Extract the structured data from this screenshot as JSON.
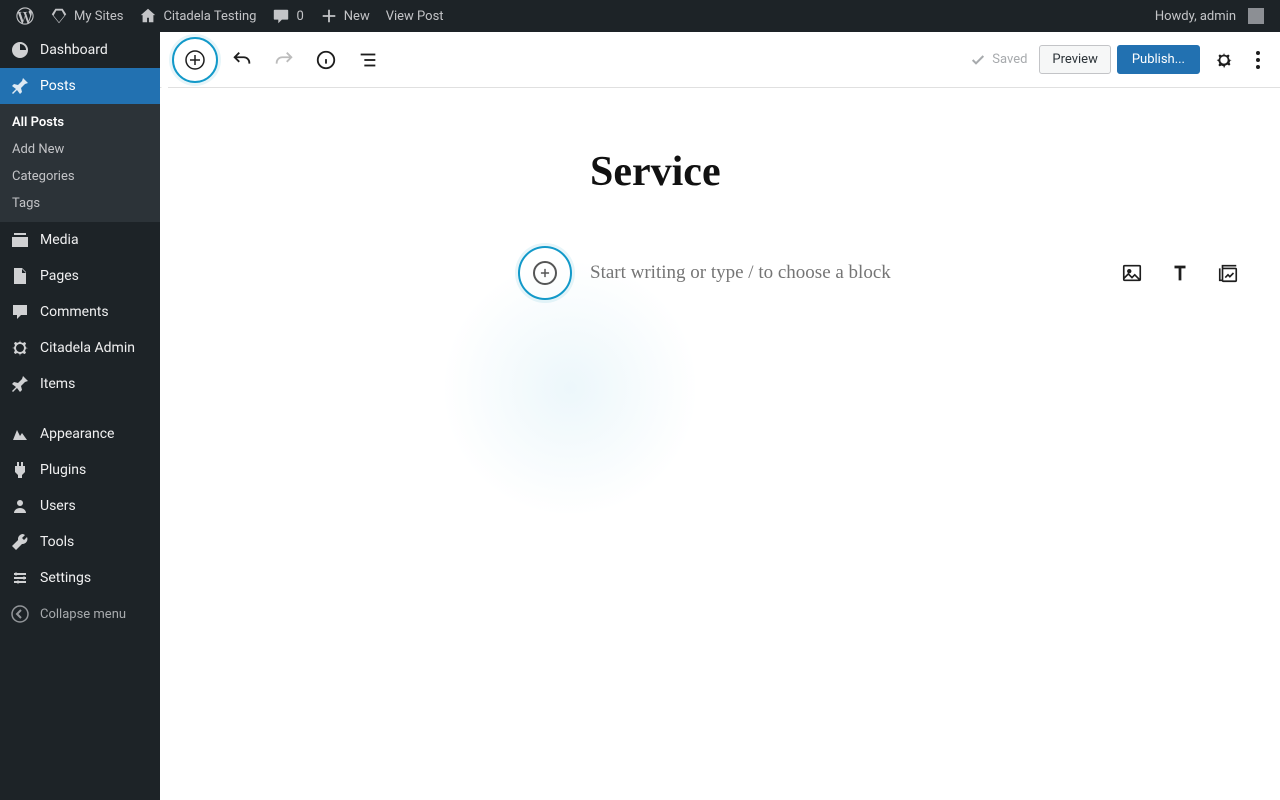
{
  "adminbar": {
    "my_sites": "My Sites",
    "site_name": "Citadela Testing",
    "comment_count": "0",
    "new": "New",
    "view_post": "View Post",
    "howdy": "Howdy, admin"
  },
  "sidebar": {
    "dashboard": "Dashboard",
    "posts": "Posts",
    "submenu": {
      "all": "All Posts",
      "add": "Add New",
      "categories": "Categories",
      "tags": "Tags"
    },
    "media": "Media",
    "pages": "Pages",
    "comments": "Comments",
    "citadela": "Citadela Admin",
    "items": "Items",
    "appearance": "Appearance",
    "plugins": "Plugins",
    "users": "Users",
    "tools": "Tools",
    "settings": "Settings",
    "collapse": "Collapse menu"
  },
  "editor": {
    "saved": "Saved",
    "preview": "Preview",
    "publish": "Publish...",
    "title": "Service",
    "placeholder": "Start writing or type / to choose a block"
  }
}
